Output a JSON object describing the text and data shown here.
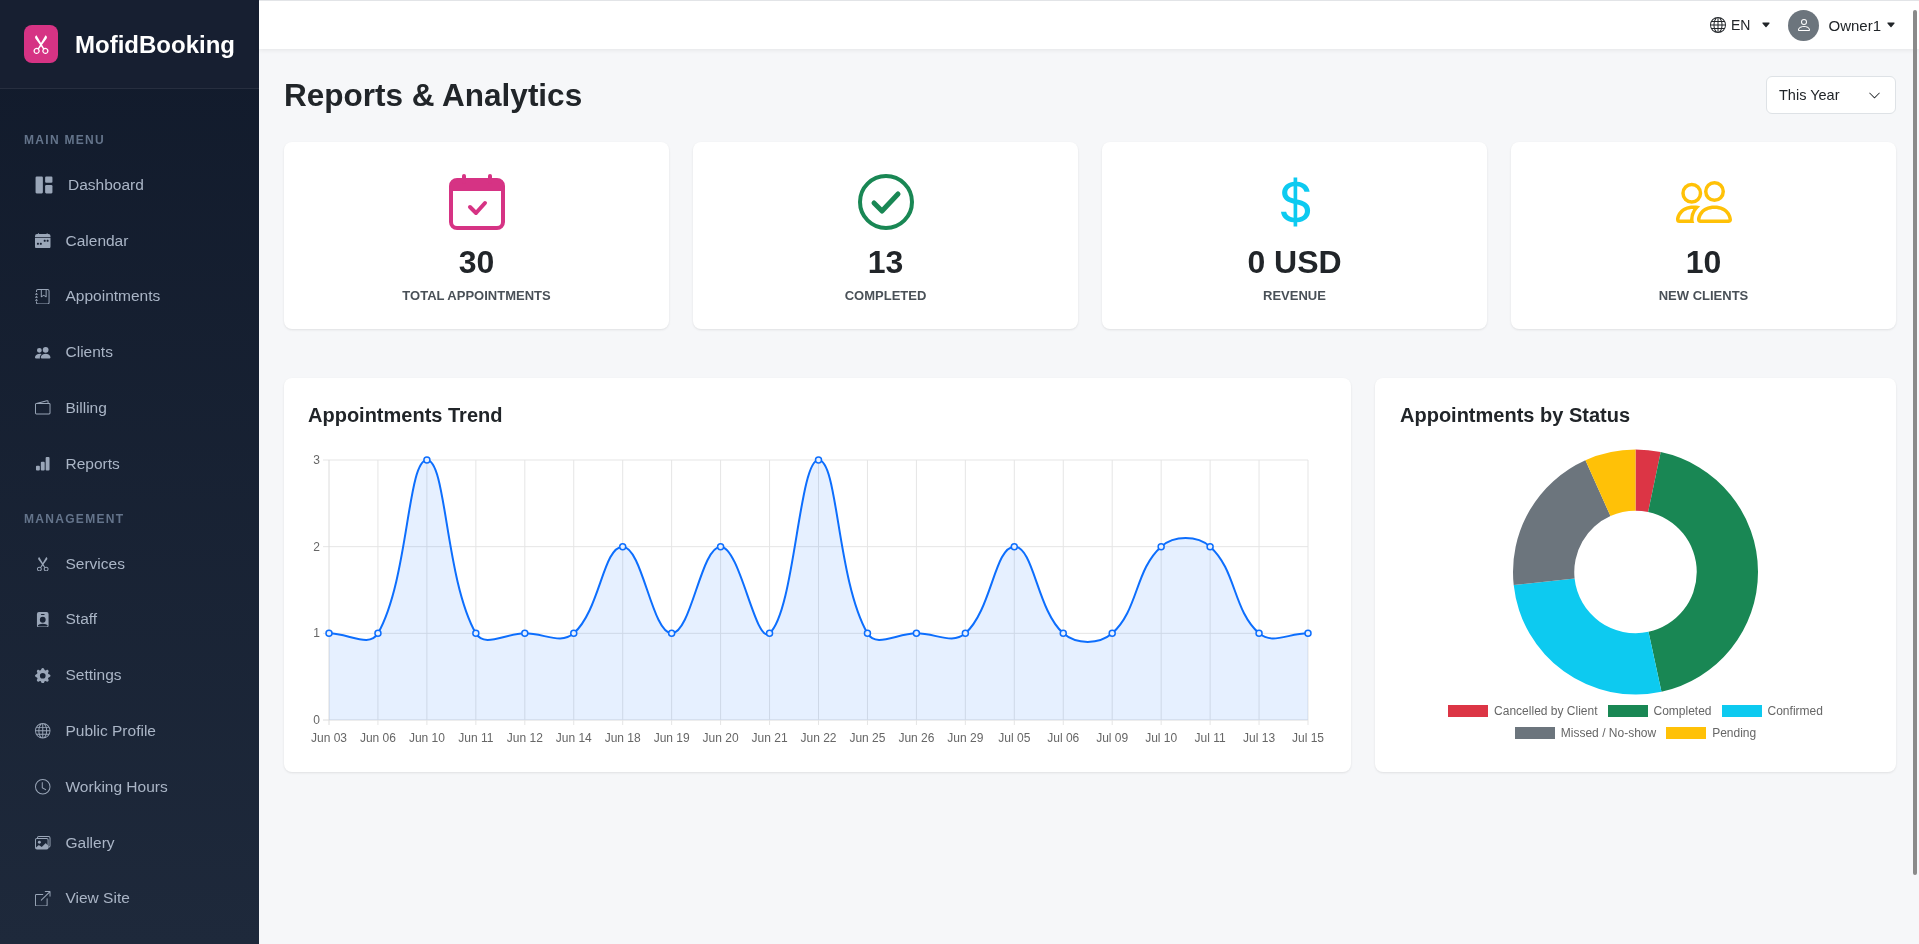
{
  "sidebar": {
    "brand": "MofidBooking",
    "sections": [
      {
        "heading": "MAIN MENU",
        "items": [
          {
            "label": "Dashboard",
            "selected": false
          },
          {
            "label": "Calendar",
            "selected": false
          },
          {
            "label": "Appointments",
            "selected": false
          },
          {
            "label": "Clients",
            "selected": false
          },
          {
            "label": "Billing",
            "selected": false
          },
          {
            "label": "Reports",
            "selected": false
          }
        ]
      },
      {
        "heading": "MANAGEMENT",
        "items": [
          {
            "label": "Services",
            "selected": false
          },
          {
            "label": "Staff",
            "selected": false
          },
          {
            "label": "Settings",
            "selected": false
          },
          {
            "label": "Public Profile",
            "selected": false
          },
          {
            "label": "Working Hours",
            "selected": false
          },
          {
            "label": "Gallery",
            "selected": false
          },
          {
            "label": "View Site",
            "selected": false
          }
        ]
      }
    ]
  },
  "top_bar": {
    "language": "EN",
    "user": "Owner1"
  },
  "header": {
    "title": "Reports & Analytics",
    "period_select": {
      "value": "This Year"
    }
  },
  "stats": [
    {
      "value": "30",
      "label": "TOTAL APPOINTMENTS"
    },
    {
      "value": "13",
      "label": "COMPLETED"
    },
    {
      "value": "0 USD",
      "label": "REVENUE"
    },
    {
      "value": "10",
      "label": "NEW CLIENTS"
    }
  ],
  "trend_card": {
    "chart_data": {
      "type": "area",
      "title": "Appointments Trend",
      "categories": [
        "Jun 03",
        "Jun 06",
        "Jun 10",
        "Jun 11",
        "Jun 12",
        "Jun 14",
        "Jun 18",
        "Jun 19",
        "Jun 20",
        "Jun 21",
        "Jun 22",
        "Jun 25",
        "Jun 26",
        "Jun 29",
        "Jul 05",
        "Jul 06",
        "Jul 09",
        "Jul 10",
        "Jul 11",
        "Jul 13",
        "Jul 15"
      ],
      "values": [
        1,
        1,
        3,
        1,
        1,
        1,
        2,
        1,
        2,
        1,
        3,
        1,
        1,
        1,
        2,
        1,
        1,
        2,
        2,
        1,
        1
      ],
      "ylim": [
        0,
        3
      ],
      "yticks": [
        0,
        1,
        2,
        3
      ],
      "grid": true
    }
  },
  "status_card": {
    "chart_data": {
      "type": "donut",
      "title": "Appointments by Status",
      "categories": [
        "Cancelled by Client",
        "Completed",
        "Confirmed",
        "Missed / No-show",
        "Pending"
      ],
      "values": [
        3.3,
        43.3,
        26.7,
        20,
        6.7
      ],
      "colors": [
        "#dc3545",
        "#198754",
        "#0dcaf0",
        "#6c757d",
        "#ffc107"
      ],
      "legend": true
    }
  }
}
